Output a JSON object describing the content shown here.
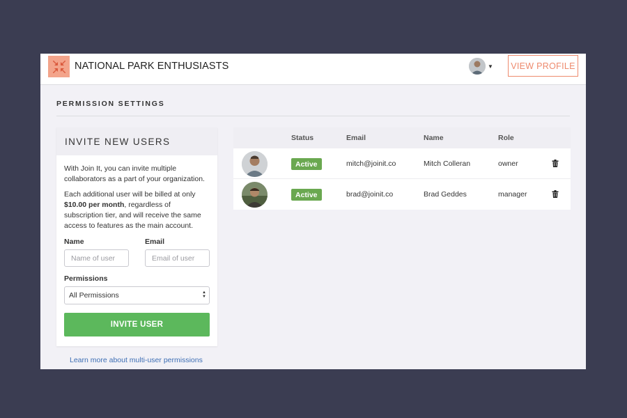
{
  "header": {
    "org_name": "NATIONAL PARK ENTHUSIASTS",
    "view_profile_label": "VIEW PROFILE",
    "logo_icon": "compress-arrows-icon",
    "brand_color": "#f3a48b",
    "accent_color": "#ee8a6d"
  },
  "page": {
    "section_title": "PERMISSION SETTINGS"
  },
  "invite": {
    "title": "INVITE NEW USERS",
    "intro": "With Join It, you can invite multiple collaborators as a part of your organization.",
    "billing_prefix": "Each additional user will be billed at only ",
    "billing_price": "$10.00 per month",
    "billing_suffix": ", regardless of subscription tier, and will receive the same access to features as the main account.",
    "name_label": "Name",
    "name_placeholder": "Name of user",
    "email_label": "Email",
    "email_placeholder": "Email of user",
    "permissions_label": "Permissions",
    "permissions_selected": "All Permissions",
    "button_label": "INVITE USER",
    "button_color": "#5cb85c"
  },
  "learn_more": "Learn more about multi-user permissions",
  "table": {
    "headers": {
      "status": "Status",
      "email": "Email",
      "name": "Name",
      "role": "Role"
    },
    "rows": [
      {
        "status": "Active",
        "email": "mitch@joinit.co",
        "name": "Mitch Colleran",
        "role": "owner"
      },
      {
        "status": "Active",
        "email": "brad@joinit.co",
        "name": "Brad Geddes",
        "role": "manager"
      }
    ],
    "status_color": "#6aa850"
  }
}
